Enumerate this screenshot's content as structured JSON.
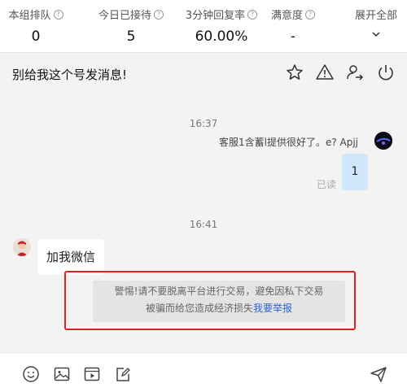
{
  "stats": [
    {
      "label": "本组排队",
      "value": "0"
    },
    {
      "label": "今日已接待",
      "value": "5"
    },
    {
      "label": "3分钟回复率",
      "value": "60.00%"
    },
    {
      "label": "满意度",
      "value": "-"
    }
  ],
  "expand": {
    "label": "展开全部"
  },
  "chat": {
    "title": "别给我这个号发消息!",
    "time1": "16:37",
    "agent_name": "客服1含蓄l提供很好了。e? Apjj",
    "agent_message": "1",
    "read_status": "已读",
    "time2": "16:41",
    "customer_message": "加我微信",
    "warning_line1": "警惕!请不要脱离平台进行交易，避免因私下交易",
    "warning_line2": "被骗而给您造成经济损失",
    "report_link": "我要举报"
  },
  "icons": {
    "header": [
      "star-icon",
      "warning-icon",
      "transfer-user-icon",
      "power-icon"
    ],
    "composer": [
      "emoji-icon",
      "image-icon",
      "video-icon",
      "edit-note-icon",
      "send-icon"
    ]
  }
}
